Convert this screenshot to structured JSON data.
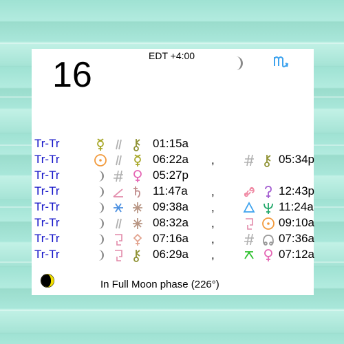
{
  "header": {
    "day": "16",
    "timezone": "EDT +4:00",
    "moon_icon": "moon-icon",
    "sign_icon": "scorpio-icon"
  },
  "aspects": [
    {
      "label": "Tr-Tr",
      "p1": "mercury",
      "asp": "parallel",
      "p2": "chiron",
      "time": "01:15a",
      "second": null
    },
    {
      "label": "Tr-Tr",
      "p1": "sun",
      "asp": "parallel",
      "p2": "mercury",
      "time": "06:22a",
      "second": {
        "asp": "contraparallel",
        "p2": "chiron",
        "time": "05:34p"
      }
    },
    {
      "label": "Tr-Tr",
      "p1": "moon",
      "asp": "contraparallel",
      "p2": "venus",
      "time": "05:27p",
      "second": null
    },
    {
      "label": "Tr-Tr",
      "p1": "moon",
      "asp": "semisquare",
      "p2": "saturn",
      "time": "11:47a",
      "second": {
        "asp": "sesquiquadrate",
        "p2": "juno",
        "time": "12:43p"
      }
    },
    {
      "label": "Tr-Tr",
      "p1": "moon",
      "asp": "sextile",
      "p2": "ceres",
      "time": "09:38a",
      "second": {
        "asp": "trine",
        "p2": "neptune",
        "time": "11:24a"
      }
    },
    {
      "label": "Tr-Tr",
      "p1": "moon",
      "asp": "parallel",
      "p2": "ceres",
      "time": "08:32a",
      "second": {
        "asp": "semisquare-alt",
        "p2": "sun",
        "time": "09:10a"
      }
    },
    {
      "label": "Tr-Tr",
      "p1": "moon",
      "asp": "semisquare-alt",
      "p2": "pallas",
      "time": "07:16a",
      "second": {
        "asp": "contraparallel",
        "p2": "node",
        "time": "07:36a"
      }
    },
    {
      "label": "Tr-Tr",
      "p1": "moon",
      "asp": "semisquare-alt",
      "p2": "chiron",
      "time": "06:29a",
      "second": {
        "asp": "quincunx",
        "p2": "venus",
        "time": "07:12a"
      }
    }
  ],
  "separator": ",",
  "footer": {
    "phase_text": "In Full Moon phase (226°)",
    "phase_icon": "moon-phase-icon"
  },
  "colors": {
    "label": "#1414c8",
    "mercury": "#a8a82a",
    "chiron": "#8f9233",
    "sun": "#f29a3c",
    "moon": "#8a8a8a",
    "venus": "#e567b5",
    "saturn": "#c08b8b",
    "juno": "#a25bd0",
    "ceres": "#b89684",
    "neptune": "#22a86a",
    "pallas": "#e2a38e",
    "node": "#9a9a9a",
    "parallel": "#b0b0b0",
    "semisquare": "#e28aaa",
    "sextile": "#4a8fe0",
    "trine": "#3ea3ee",
    "sesquiquadrate": "#f08ca6",
    "quincunx": "#2fc02f"
  }
}
